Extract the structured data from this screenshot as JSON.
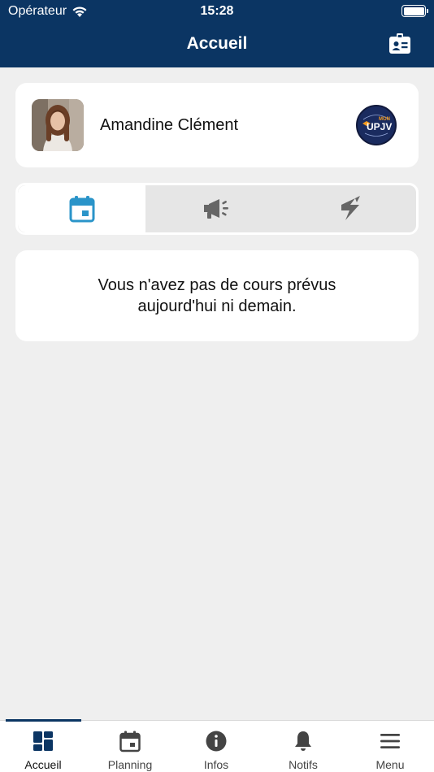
{
  "status_bar": {
    "carrier": "Opérateur",
    "time": "15:28"
  },
  "header": {
    "title": "Accueil",
    "action_icon": "id-badge-icon"
  },
  "profile": {
    "name": "Amandine Clément",
    "logo_top": "MON",
    "logo_main": "UPJV"
  },
  "tabs": [
    {
      "icon": "calendar-icon",
      "selected": true
    },
    {
      "icon": "megaphone-icon",
      "selected": false
    },
    {
      "icon": "flash-icon",
      "selected": false
    }
  ],
  "empty_state": {
    "message": "Vous n'avez pas de cours prévus aujourd'hui ni demain."
  },
  "bottom_nav": {
    "items": [
      {
        "label": "Accueil",
        "icon": "dashboard-icon",
        "active": true
      },
      {
        "label": "Planning",
        "icon": "calendar-icon",
        "active": false
      },
      {
        "label": "Infos",
        "icon": "info-icon",
        "active": false
      },
      {
        "label": "Notifs",
        "icon": "bell-icon",
        "active": false
      },
      {
        "label": "Menu",
        "icon": "menu-icon",
        "active": false
      }
    ]
  },
  "colors": {
    "primary": "#0b3563",
    "accent": "#2a94c9",
    "background": "#efefef",
    "logo_orange": "#f29a1f"
  }
}
